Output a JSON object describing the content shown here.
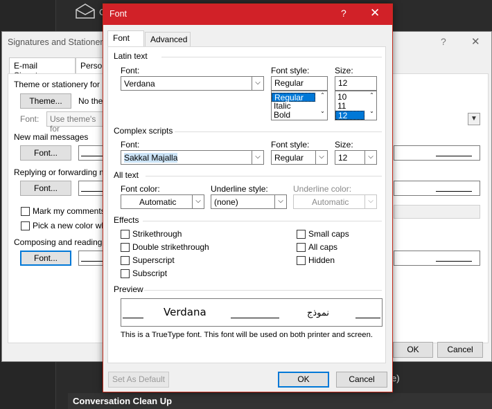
{
  "background": {
    "top_text": "C",
    "bottom_text": "e)",
    "cleanup_title": "Conversation Clean Up"
  },
  "signatures_dialog": {
    "title": "Signatures and Stationery",
    "help": "?",
    "close": "✕",
    "tabs": [
      "E-mail Signature",
      "Perso"
    ],
    "theme_section": "Theme or stationery for n",
    "theme_button": "Theme...",
    "theme_value": "No ther",
    "font_label": "Font:",
    "font_combo": "Use theme's for",
    "new_mail_section": "New mail messages",
    "new_mail_font_button": "Font...",
    "reply_section": "Replying or forwarding m",
    "reply_font_button": "Font...",
    "mark_comments": "Mark my comments v",
    "pick_color": "Pick a new color whe",
    "composing_section": "Composing and reading p",
    "composing_font_button": "Font...",
    "ok": "OK",
    "cancel": "Cancel"
  },
  "font_dialog": {
    "title": "Font",
    "help": "?",
    "close": "✕",
    "tabs": {
      "font": "Font",
      "advanced": "Advanced"
    },
    "latin": {
      "section": "Latin text",
      "font_label": "Font:",
      "font_value": "Verdana",
      "style_label": "Font style:",
      "style_value": "Regular",
      "style_options": [
        "Regular",
        "Italic",
        "Bold"
      ],
      "size_label": "Size:",
      "size_value": "12",
      "size_options": [
        "10",
        "11",
        "12"
      ]
    },
    "complex": {
      "section": "Complex scripts",
      "font_label": "Font:",
      "font_value": "Sakkal Majalla",
      "style_label": "Font style:",
      "style_value": "Regular",
      "size_label": "Size:",
      "size_value": "12"
    },
    "all_text": {
      "section": "All text",
      "color_label": "Font color:",
      "color_value": "Automatic",
      "underline_label": "Underline style:",
      "underline_value": "(none)",
      "underline_color_label": "Underline color:",
      "underline_color_value": "Automatic"
    },
    "effects": {
      "section": "Effects",
      "strikethrough": "Strikethrough",
      "double_strikethrough": "Double strikethrough",
      "superscript": "Superscript",
      "subscript": "Subscript",
      "small_caps": "Small caps",
      "all_caps": "All caps",
      "hidden": "Hidden"
    },
    "preview": {
      "section": "Preview",
      "sample_text": "Verdana",
      "arabic_text": "نموذج",
      "note": "This is a TrueType font. This font will be used on both printer and screen."
    },
    "buttons": {
      "set_default": "Set As Default",
      "ok": "OK",
      "cancel": "Cancel"
    }
  }
}
